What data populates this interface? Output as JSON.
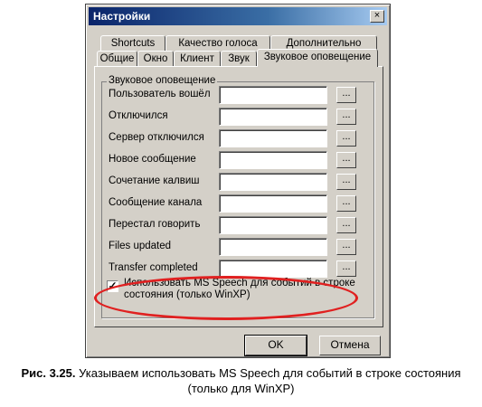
{
  "window": {
    "title": "Настройки",
    "close_glyph": "×"
  },
  "tabs_top": [
    "Shortcuts",
    "Качество голоса",
    "Дополнительно"
  ],
  "tabs_bottom": [
    "Общие",
    "Окно",
    "Клиент",
    "Звук",
    "Звуковое оповещение"
  ],
  "active_tab": "Звуковое оповещение",
  "group": {
    "title": "Звуковое оповещение",
    "rows": [
      {
        "label": "Пользователь вошёл",
        "value": ""
      },
      {
        "label": "Отключился",
        "value": ""
      },
      {
        "label": "Сервер отключился",
        "value": ""
      },
      {
        "label": "Новое сообщение",
        "value": ""
      },
      {
        "label": "Сочетание калвиш",
        "value": ""
      },
      {
        "label": "Сообщение канала",
        "value": ""
      },
      {
        "label": "Перестал говорить",
        "value": ""
      },
      {
        "label": "Files updated",
        "value": ""
      },
      {
        "label": "Transfer completed",
        "value": ""
      }
    ],
    "browse_label": "...",
    "checkbox": {
      "checked": true,
      "mark": "✓",
      "label": "Использовать MS Speech для событий в строке состояния (только WinXP)"
    }
  },
  "buttons": {
    "ok": "OK",
    "cancel": "Отмена"
  },
  "caption": {
    "prefix": "Рис. 3.25.",
    "text": " Указываем использовать MS Speech для событий в строке состояния (только для WinXP)"
  },
  "colors": {
    "highlight": "#e02020",
    "titlebar": "#0a246a",
    "face": "#d4d0c8"
  }
}
